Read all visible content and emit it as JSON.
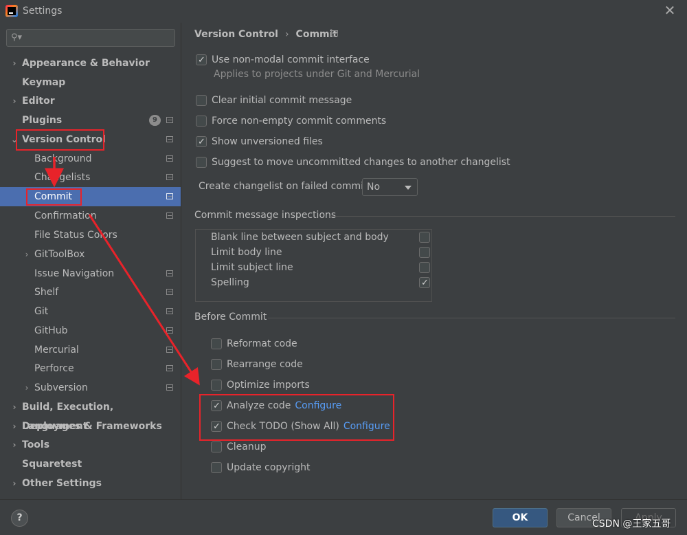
{
  "window": {
    "title": "Settings"
  },
  "sidebar": {
    "search_placeholder": "",
    "items": [
      {
        "label": "Appearance & Behavior",
        "bold": true,
        "expandable": true
      },
      {
        "label": "Keymap",
        "bold": true
      },
      {
        "label": "Editor",
        "bold": true,
        "expandable": true
      },
      {
        "label": "Plugins",
        "bold": true,
        "badge": "9"
      },
      {
        "label": "Version Control",
        "bold": true,
        "expanded": true
      },
      {
        "label": "Background"
      },
      {
        "label": "Changelists"
      },
      {
        "label": "Commit",
        "selected": true
      },
      {
        "label": "Confirmation"
      },
      {
        "label": "File Status Colors"
      },
      {
        "label": "GitToolBox",
        "expandable": true
      },
      {
        "label": "Issue Navigation"
      },
      {
        "label": "Shelf"
      },
      {
        "label": "Git"
      },
      {
        "label": "GitHub"
      },
      {
        "label": "Mercurial"
      },
      {
        "label": "Perforce"
      },
      {
        "label": "Subversion",
        "expandable": true
      },
      {
        "label": "Build, Execution, Deployment",
        "bold": true,
        "expandable": true
      },
      {
        "label": "Languages & Frameworks",
        "bold": true,
        "expandable": true
      },
      {
        "label": "Tools",
        "bold": true,
        "expandable": true
      },
      {
        "label": "Squaretest",
        "bold": true
      },
      {
        "label": "Other Settings",
        "bold": true,
        "expandable": true
      }
    ]
  },
  "breadcrumb": {
    "parent": "Version Control",
    "sep": "›",
    "current": "Commit"
  },
  "options": {
    "non_modal": {
      "label": "Use non-modal commit interface",
      "checked": true,
      "hint": "Applies to projects under Git and Mercurial"
    },
    "clear_initial": {
      "label": "Clear initial commit message",
      "checked": false
    },
    "force_non_empty": {
      "label": "Force non-empty commit comments",
      "checked": false
    },
    "show_unversioned": {
      "label": "Show unversioned files",
      "checked": true
    },
    "suggest_move": {
      "label": "Suggest to move uncommitted changes to another changelist",
      "checked": false
    }
  },
  "create_changelist": {
    "label": "Create changelist on failed commit:",
    "value": "No"
  },
  "inspections": {
    "title": "Commit message inspections",
    "items": [
      {
        "label": "Blank line between subject and body",
        "checked": false
      },
      {
        "label": "Limit body line",
        "checked": false
      },
      {
        "label": "Limit subject line",
        "checked": false
      },
      {
        "label": "Spelling",
        "checked": true
      }
    ]
  },
  "before_commit": {
    "title": "Before Commit",
    "items": [
      {
        "label": "Reformat code",
        "checked": false
      },
      {
        "label": "Rearrange code",
        "checked": false
      },
      {
        "label": "Optimize imports",
        "checked": false
      },
      {
        "label": "Analyze code",
        "checked": true,
        "link": "Configure"
      },
      {
        "label": "Check TODO (Show All)",
        "checked": true,
        "link": "Configure"
      },
      {
        "label": "Cleanup",
        "checked": false
      },
      {
        "label": "Update copyright",
        "checked": false
      }
    ]
  },
  "footer": {
    "help": "?",
    "ok": "OK",
    "cancel": "Cancel",
    "apply": "Apply"
  },
  "watermark": "CSDN @王家五哥",
  "colors": {
    "selection": "#4b6eaf",
    "annotation_red": "#e8232a",
    "link": "#589df6",
    "background": "#3c3f41"
  }
}
